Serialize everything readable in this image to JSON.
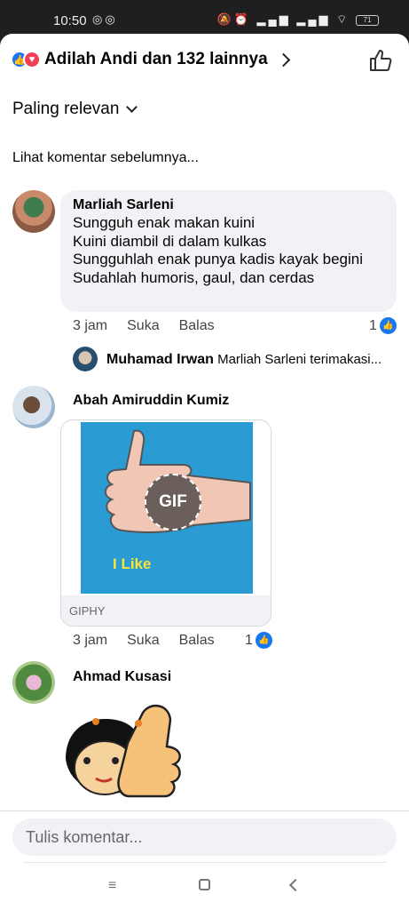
{
  "status": {
    "time": "10:50",
    "battery": "71"
  },
  "header": {
    "reactions_text": "Adilah Andi dan 132 lainnya"
  },
  "sort": {
    "label": "Paling relevan"
  },
  "prev_comments": "Lihat komentar sebelumnya...",
  "comments": [
    {
      "author": "Marliah Sarleni",
      "lines": [
        "Sungguh enak makan kuini",
        "Kuini diambil di dalam kulkas",
        "Sungguhlah enak punya kadis kayak begini",
        "Sudahlah humoris, gaul, dan cerdas"
      ],
      "time": "3 jam",
      "like": "Suka",
      "reply": "Balas",
      "likes": "1",
      "reply_preview": {
        "author": "Muhamad Irwan",
        "text": "Marliah Sarleni terimakasi..."
      }
    },
    {
      "author": "Abah Amiruddin Kumiz",
      "gif": {
        "badge": "GIF",
        "caption": "I Like",
        "source": "GIPHY"
      },
      "time": "3 jam",
      "like": "Suka",
      "reply": "Balas",
      "likes": "1"
    },
    {
      "author": "Ahmad Kusasi"
    }
  ],
  "composer": {
    "placeholder": "Tulis komentar..."
  },
  "nav": {
    "menu_icon": "≡"
  },
  "colors": {
    "accent": "#1877f2",
    "bubble": "#f0f2f5",
    "love": "#f33e58"
  }
}
